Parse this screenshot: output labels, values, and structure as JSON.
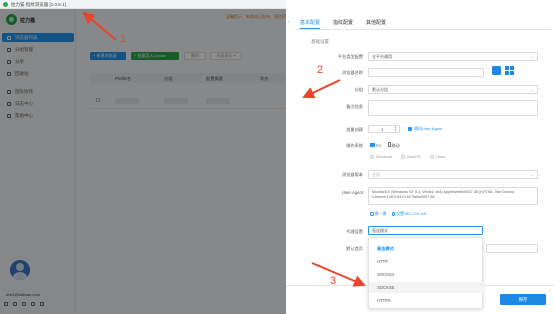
{
  "titlebar": {
    "title": "拉力猫 指纹浏览器 [1.0.6.1]"
  },
  "sidebar": {
    "brand": "拉力猫",
    "items": [
      {
        "label": "浏览器列表",
        "active": true
      },
      {
        "label": "分组管理",
        "active": false
      },
      {
        "label": "分享",
        "active": false
      },
      {
        "label": "回收站",
        "active": false
      },
      {
        "label": "团队协作",
        "active": false
      },
      {
        "label": "日志中心",
        "active": false
      },
      {
        "label": "帮助中心",
        "active": false
      }
    ],
    "user_email": "test1@lalimao.com"
  },
  "main": {
    "notice": "温馨提示：新版本已发布，请及时更新",
    "new_button": "+ 新建浏览器",
    "import_button": "+ 批量导入Cookie",
    "gray_button_1": "删除",
    "gray_button_2": "批量操作 ▾",
    "columns": [
      "Profile名",
      "分组",
      "配置摘要",
      "状态"
    ]
  },
  "panel": {
    "tabs": [
      "基本配置",
      "指纹配置",
      "其他配置"
    ],
    "section_title": "基础设置",
    "platform": {
      "label": "平台类型配置",
      "value": "全平台通用"
    },
    "name": {
      "label": "浏览器名称"
    },
    "group": {
      "label": "分组",
      "value": "默认分组"
    },
    "remark": {
      "label": "备注信息"
    },
    "batch": {
      "label": "批量创建",
      "count": "1",
      "random_ua": "随机User-Agent"
    },
    "os": {
      "label": "操作系统",
      "desktop": "PC",
      "mobile": "移动",
      "options": [
        "Windows",
        "MacOS",
        "Linux"
      ]
    },
    "browser_version": {
      "label": "浏览器版本",
      "value": "全部"
    },
    "ua": {
      "label": "User-Agent",
      "value": "Mozilla/5.0 (Windows NT 6.1; Win64; x64) AppleWebKit/537.36 (KHTML, like Gecko) Chrome/128.0.6470.62 Safari/537.36",
      "action_1": "换一换",
      "action_2": "设置SEC-CH-UA"
    },
    "proxy": {
      "label": "代理设置",
      "value": "直连模式"
    },
    "homepage": {
      "label": "默认首页"
    },
    "dropdown_options": [
      "直连模式",
      "HTTP",
      "SOCKS4",
      "SOCKS5",
      "HTTPS"
    ],
    "save_button": "保存"
  },
  "annotations": {
    "numbers": [
      "1",
      "2",
      "3"
    ],
    "color": "#e8452c"
  }
}
